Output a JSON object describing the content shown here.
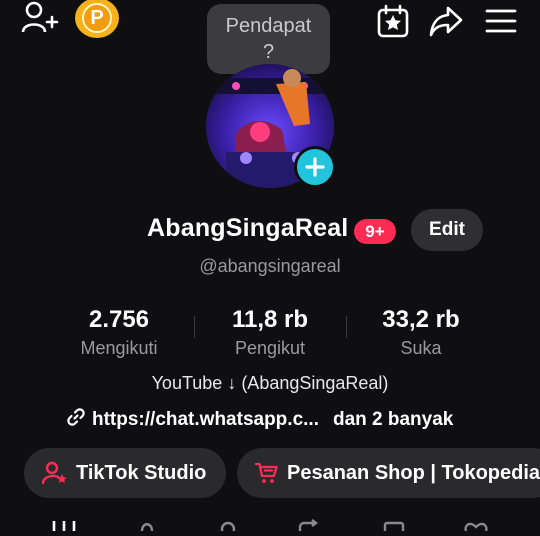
{
  "top_bar": {
    "icons": [
      "add-user-icon",
      "coin-icon",
      "calendar-star-icon",
      "share-icon",
      "menu-icon"
    ],
    "coin_letter": "P"
  },
  "tooltip": {
    "line1": "Pendapat",
    "line2": "?"
  },
  "profile": {
    "display_name": "AbangSingaReal",
    "notification_badge": "9+",
    "edit_label": "Edit",
    "username": "@abangsingareal"
  },
  "stats": [
    {
      "value": "2.756",
      "label": "Mengikuti"
    },
    {
      "value": "11,8 rb",
      "label": "Pengikut"
    },
    {
      "value": "33,2 rb",
      "label": "Suka"
    }
  ],
  "bio": {
    "text": "YouTube ↓  (AbangSingaReal)",
    "link": "https://chat.whatsapp.c...",
    "link_more": "dan 2 banyak"
  },
  "actions": {
    "studio_label": "TikTok Studio",
    "shop_label": "Pesanan Shop | Tokopedia"
  },
  "colors": {
    "background": "#0f0f11",
    "badge": "#fe2c55",
    "avatar_add": "#22c4dc",
    "coin": "#f6b21a",
    "pill": "#2a2a2d"
  }
}
